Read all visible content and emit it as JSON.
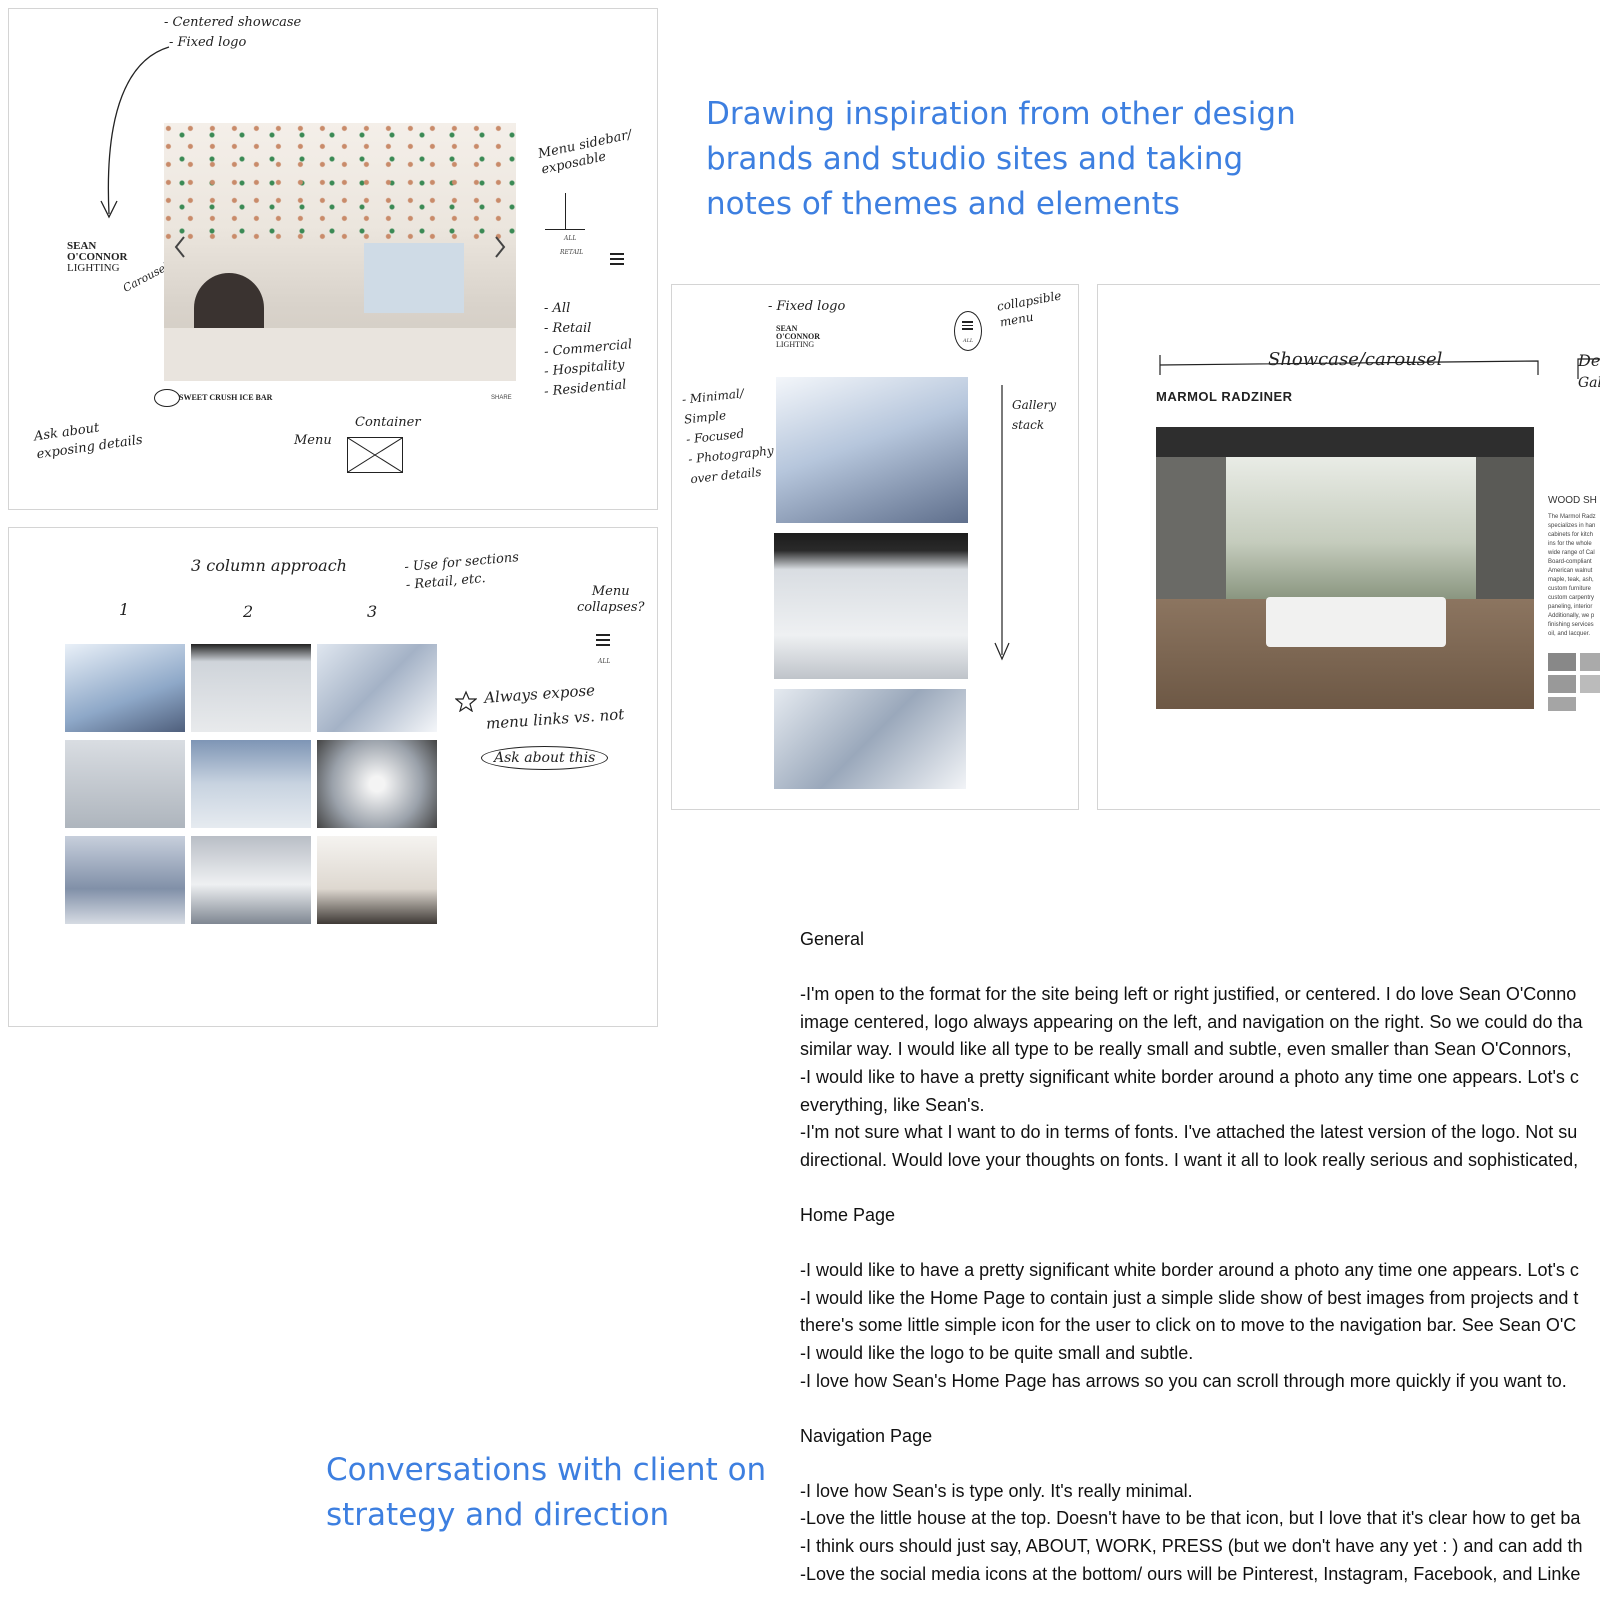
{
  "headings": {
    "inspiration": [
      "Drawing inspiration from other design",
      "brands and studio sites and taking",
      "notes of themes and elements"
    ],
    "conversations": [
      "Conversations with client on",
      "strategy and direction"
    ]
  },
  "sketch1": {
    "notes_top": [
      "- Centered showcase",
      "- Fixed logo"
    ],
    "logo": [
      "SEAN",
      "O'CONNOR",
      "LIGHTING"
    ],
    "carousel_label": "Carousel",
    "menu_note": [
      "Menu sidebar/",
      "exposable"
    ],
    "nav_preview": [
      "ALL",
      "RETAIL"
    ],
    "nav_list": [
      "- All",
      "- Retail",
      "- Commercial",
      "- Hospitality",
      "- Residential"
    ],
    "caption": "SWEET CRUSH ICE BAR",
    "share": "SHARE",
    "ask_note": [
      "Ask about",
      "exposing details"
    ],
    "menu_label": "Menu",
    "container_label": "Container"
  },
  "sketch2": {
    "title": "3 column approach",
    "note": [
      "- Use for sections",
      "- Retail, etc."
    ],
    "col_numbers": [
      "1",
      "2",
      "3"
    ],
    "menu_note": [
      "Menu",
      "collapses?"
    ],
    "all_label": "ALL",
    "expose_note": [
      "Always expose",
      "menu links vs. not"
    ],
    "ask_oval": "Ask about this"
  },
  "sketch3": {
    "fixed_logo": "- Fixed logo",
    "logo": [
      "SEAN",
      "O'CONNOR",
      "LIGHTING"
    ],
    "collapsible": [
      "collapsible",
      "menu"
    ],
    "all_label": "ALL",
    "left_notes": [
      "- Minimal/",
      "Simple",
      "- Focused",
      "- Photography",
      "over details"
    ],
    "gallery_note": [
      "Gallery",
      "stack"
    ]
  },
  "sketch4": {
    "showcase": "Showcase/carousel",
    "partial": [
      "De",
      "Gal"
    ],
    "brand": "MARMOL RADZINER",
    "side_title": "WOOD SH",
    "side_text": [
      "The Marmol Radz",
      "specializes in han",
      "cabinets for kitch",
      "ins for the whole",
      "wide range of Cal",
      "Board-compliant",
      "American walnut",
      "maple, teak, ash,",
      "custom furniture",
      "custom carpentry",
      "paneling, interior",
      "Additionally, we p",
      "finishing services",
      "oil, and lacquer."
    ]
  },
  "notes": [
    {
      "type": "heading",
      "text": "General"
    },
    {
      "type": "gap"
    },
    {
      "type": "line",
      "text": "-I'm open to the format for the site being left or right justified, or centered. I do love Sean O'Conno"
    },
    {
      "type": "line",
      "text": "image centered, logo always appearing on the left, and navigation on the right. So we could do tha"
    },
    {
      "type": "line",
      "text": "similar way. I would like all type to be really small and subtle, even smaller than Sean O'Connors,"
    },
    {
      "type": "line",
      "text": "-I would like to have a pretty significant white border around a photo any time one appears. Lot's c"
    },
    {
      "type": "line",
      "text": "everything, like Sean's."
    },
    {
      "type": "line",
      "text": "-I'm not sure what I want to do in terms of fonts. I've attached the latest version of the logo. Not su"
    },
    {
      "type": "line",
      "text": "directional. Would love your thoughts on fonts. I want it all to look really serious and sophisticated,"
    },
    {
      "type": "gap"
    },
    {
      "type": "heading",
      "text": "Home Page"
    },
    {
      "type": "gap"
    },
    {
      "type": "line",
      "text": "-I would like to have a pretty significant white border around a photo any time one appears. Lot's c"
    },
    {
      "type": "line",
      "text": "-I would like the Home Page to contain just a simple slide show of best images from projects and t"
    },
    {
      "type": "line",
      "text": "there's some little simple icon for the user to click on to move to the navigation bar. See Sean O'C"
    },
    {
      "type": "line",
      "text": "-I  would like the logo to be quite small and subtle."
    },
    {
      "type": "line",
      "text": "-I love how Sean's Home Page has arrows so you can scroll through more quickly if you want to."
    },
    {
      "type": "gap"
    },
    {
      "type": "heading",
      "text": "Navigation Page"
    },
    {
      "type": "gap"
    },
    {
      "type": "line",
      "text": "-I love how Sean's is type only. It's really minimal."
    },
    {
      "type": "line",
      "text": "-Love the little house at the top. Doesn't have to be that icon, but I love that it's clear how to get ba"
    },
    {
      "type": "line",
      "text": "-I think ours should just say, ABOUT, WORK, PRESS (but we don't have any yet : ) and can add th"
    },
    {
      "type": "line",
      "text": "-Love the social media icons at the bottom/ ours will be Pinterest, Instagram, Facebook, and Linke"
    }
  ]
}
